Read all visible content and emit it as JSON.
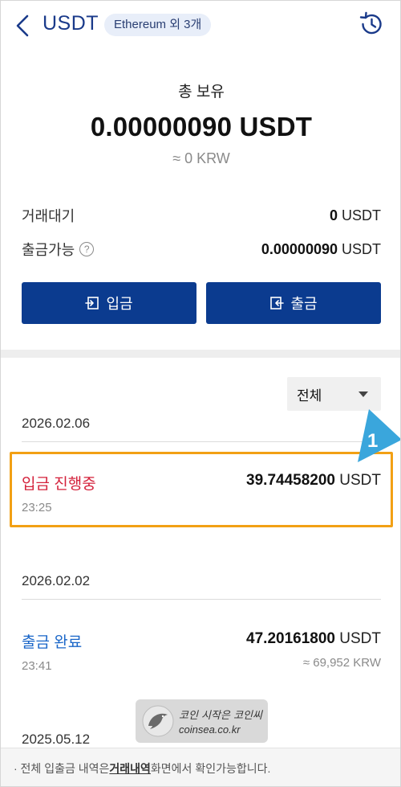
{
  "header": {
    "coin": "USDT",
    "network_badge": "Ethereum 외 3개"
  },
  "balance": {
    "total_label": "총 보유",
    "total_amount": "0.00000090 USDT",
    "total_krw": "≈ 0 KRW",
    "pending_label": "거래대기",
    "pending_number": "0",
    "pending_unit": " USDT",
    "withdrawable_label": "출금가능",
    "withdrawable_number": "0.00000090",
    "withdrawable_unit": " USDT",
    "help_glyph": "?"
  },
  "actions": {
    "deposit_label": "입금",
    "withdraw_label": "출금"
  },
  "filter": {
    "selected": "전체"
  },
  "groups": [
    {
      "date": "2026.02.06",
      "items": [
        {
          "status": "입금 진행중",
          "time": "23:25",
          "amount_number": "39.74458200",
          "amount_unit": " USDT"
        }
      ]
    },
    {
      "date": "2026.02.02",
      "items": [
        {
          "status": "출금 완료",
          "time": "23:41",
          "amount_number": "47.20161800",
          "amount_unit": " USDT",
          "krw": "≈ 69,952 KRW"
        }
      ]
    },
    {
      "date": "2025.05.12",
      "items": []
    }
  ],
  "annotation": {
    "callout_number": "1",
    "highlight_color": "#f2a014",
    "callout_color": "#3aa6dc"
  },
  "watermark": {
    "line1": "코인 시작은 코인씨",
    "line2": "coinsea.co.kr"
  },
  "footer": {
    "prefix": "· 전체 입출금 내역은 ",
    "link": "거래내역",
    "suffix": " 화면에서 확인가능합니다."
  },
  "colors": {
    "primary": "#0b3b8f",
    "title_blue": "#1a3a8a",
    "status_red": "#d4213b",
    "status_blue": "#1a66c8"
  }
}
